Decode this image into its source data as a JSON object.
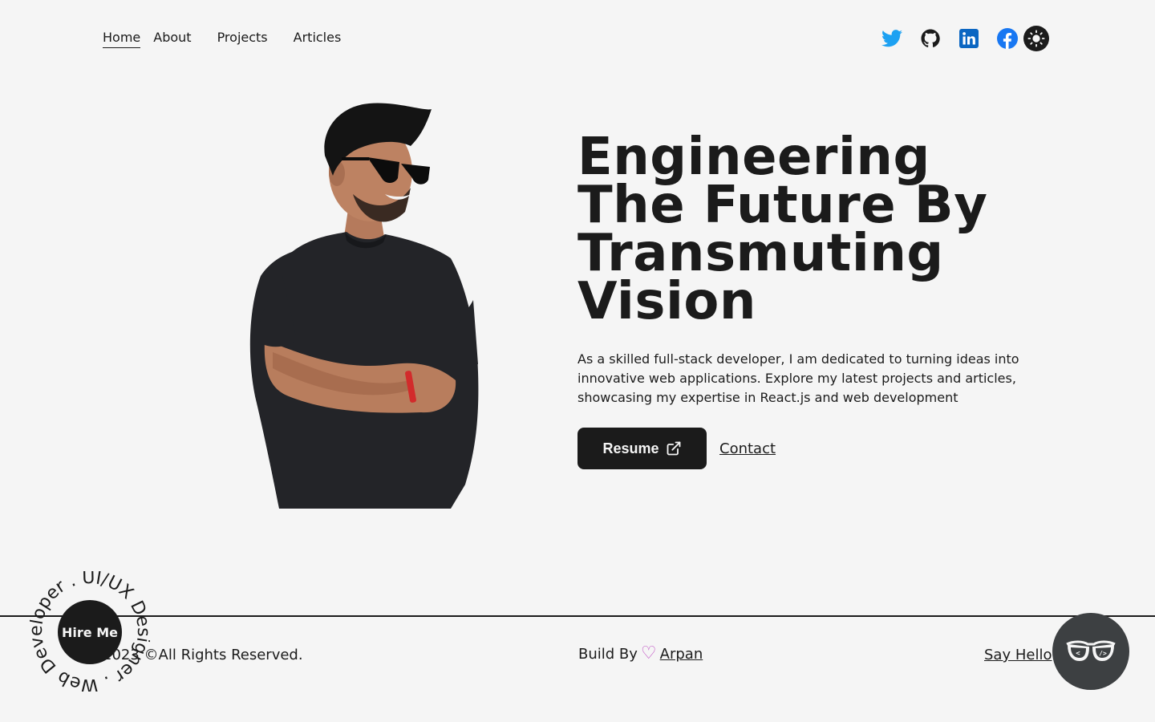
{
  "nav": {
    "links": [
      {
        "label": "Home",
        "active": true
      },
      {
        "label": "About",
        "active": false
      },
      {
        "label": "Projects",
        "active": false
      },
      {
        "label": "Articles",
        "active": false
      }
    ],
    "socials": [
      "twitter-icon",
      "github-icon",
      "linkedin-icon",
      "facebook-icon"
    ],
    "theme_toggle_icon": "sun-icon"
  },
  "hero": {
    "title": "Engineering The Future By Transmuting Vision",
    "description": "As a skilled full-stack developer, I am dedicated to turning ideas into innovative web applications. Explore my latest projects and articles, showcasing my expertise in React.js and web development",
    "resume_label": "Resume",
    "contact_label": "Contact"
  },
  "footer": {
    "copyright": "2023 ©All Rights Reserved.",
    "built_by_prefix": "Build By",
    "heart": "♡",
    "author": "Arpan",
    "say_hello": "Say Hello"
  },
  "hire": {
    "label": "Hire Me",
    "ring_text": "Web Developer . UI/UX Designer . "
  },
  "colors": {
    "background": "#f5f5f5",
    "dark": "#1b1b1b",
    "heart": "#c052c4",
    "twitter": "#1da1f2",
    "linkedin": "#0a66c2",
    "facebook": "#1877f2",
    "float_button": "#3d4042"
  }
}
